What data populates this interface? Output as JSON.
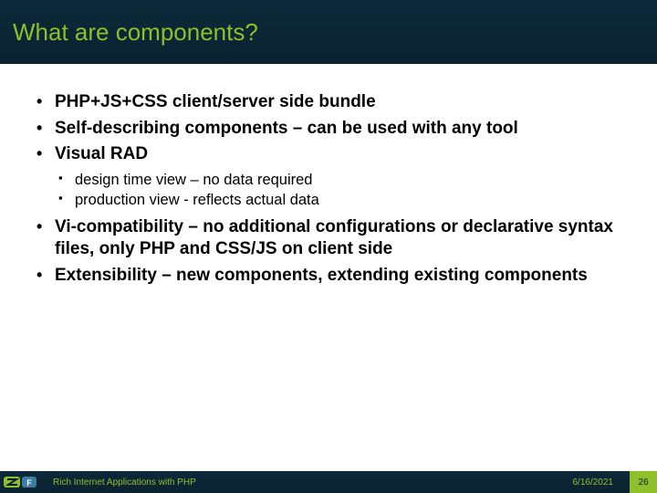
{
  "title": "What are components?",
  "bullets": {
    "b0": "PHP+JS+CSS client/server side bundle",
    "b1": "Self-describing components – can be used with any tool",
    "b2": "Visual RAD",
    "b2sub": {
      "s0": "design time view – no data required",
      "s1": "production view - reflects actual data"
    },
    "b3": "Vi-compatibility – no additional configurations or declarative syntax files, only PHP and CSS/JS on client side",
    "b4": "Extensibility – new components, extending existing components"
  },
  "footer": {
    "title": "Rich Internet Applications with PHP",
    "date": "6/16/2021",
    "page": "26"
  }
}
